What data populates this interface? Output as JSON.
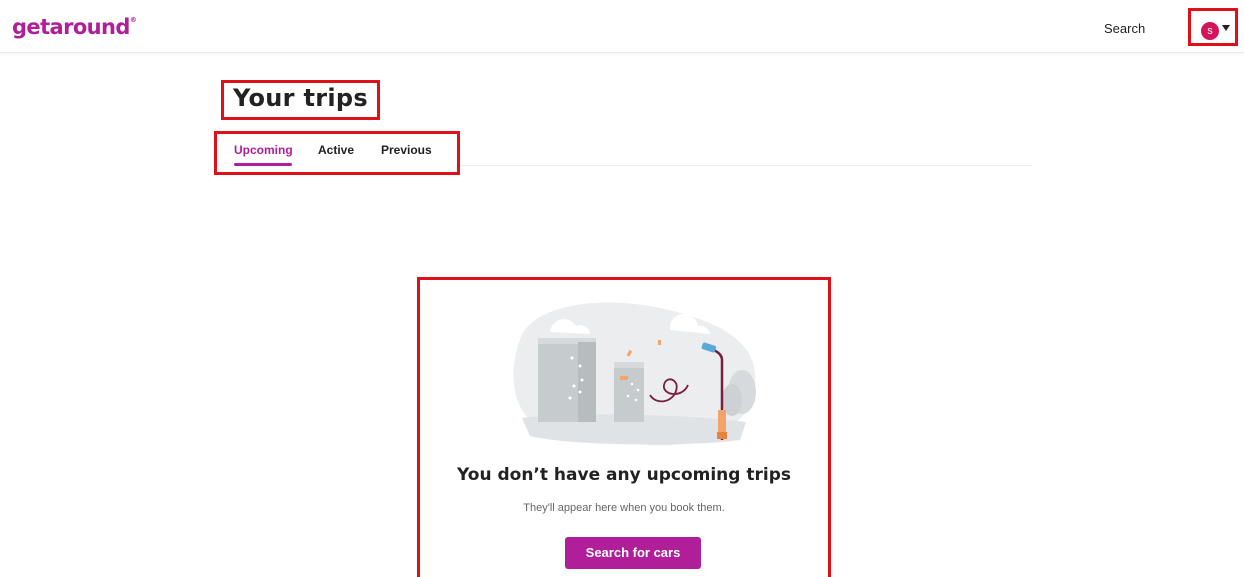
{
  "header": {
    "logo": "getaround",
    "logo_mark": "®",
    "search_link": "Search",
    "avatar_initial": "s",
    "menu_icon": "caret-down-icon"
  },
  "page": {
    "title": "Your trips",
    "tabs": [
      {
        "label": "Upcoming",
        "active": true
      },
      {
        "label": "Active",
        "active": false
      },
      {
        "label": "Previous",
        "active": false
      }
    ]
  },
  "empty_state": {
    "illustration": "city-street-illustration",
    "title": "You don’t have any upcoming trips",
    "subtitle": "They'll appear here when you book them.",
    "button_label": "Search for cars"
  },
  "colors": {
    "brand": "#b01e9a",
    "avatar": "#d4145a",
    "highlight_border": "#e0101a"
  }
}
